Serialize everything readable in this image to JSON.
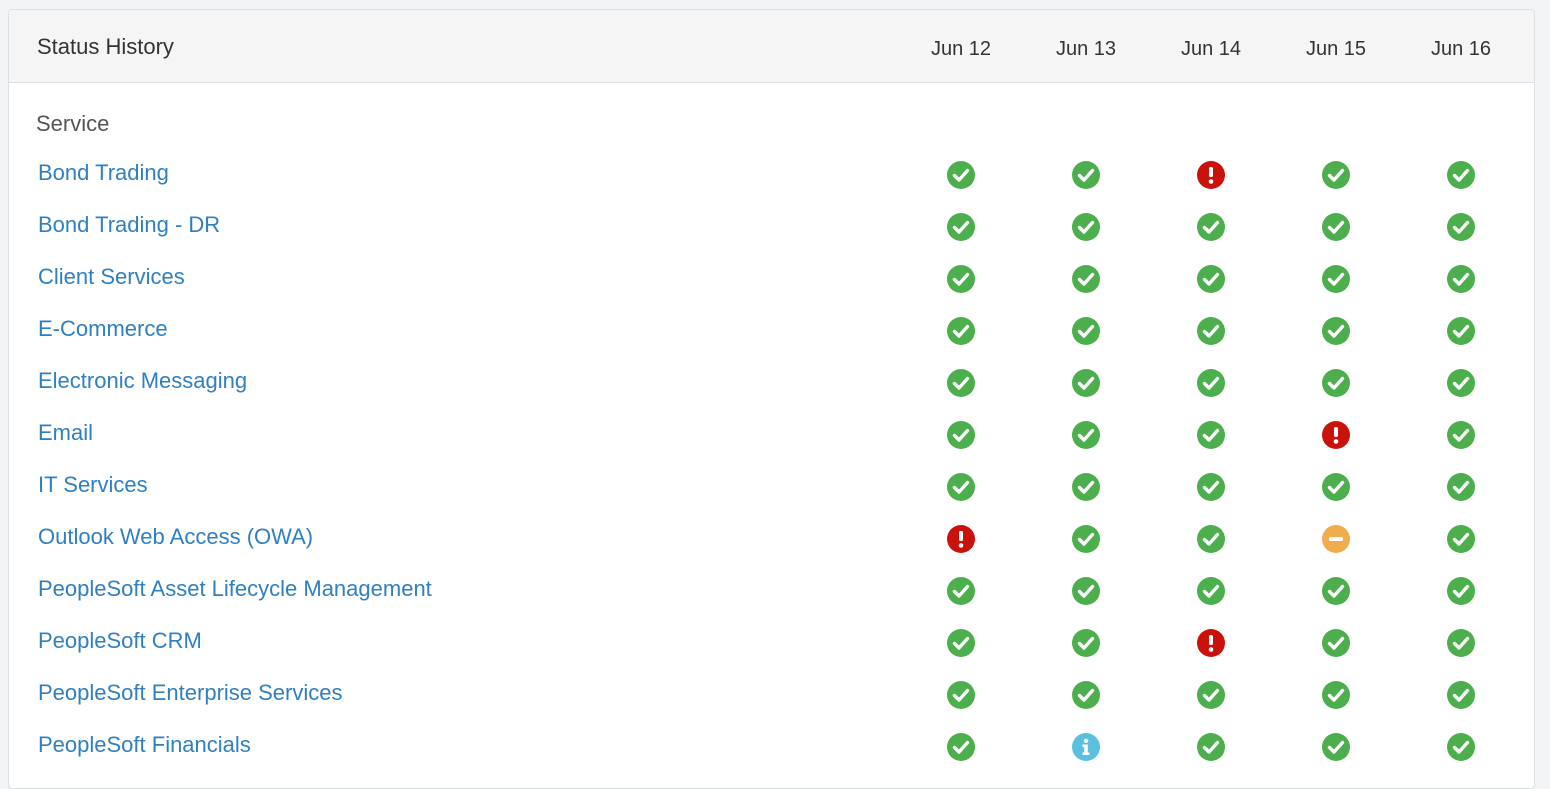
{
  "panel": {
    "title": "Status History",
    "section_label": "Service",
    "dates": [
      "Jun 12",
      "Jun 13",
      "Jun 14",
      "Jun 15",
      "Jun 16"
    ]
  },
  "status_colors": {
    "ok": "#4cae4c",
    "outage": "#c9120b",
    "degraded": "#f0ad4e",
    "info": "#5bc0de"
  },
  "status_icons": {
    "ok": "check-circle-icon",
    "outage": "exclamation-circle-icon",
    "degraded": "minus-circle-icon",
    "info": "info-circle-icon"
  },
  "services": [
    {
      "name": "Bond Trading",
      "statuses": [
        "ok",
        "ok",
        "outage",
        "ok",
        "ok"
      ]
    },
    {
      "name": "Bond Trading - DR",
      "statuses": [
        "ok",
        "ok",
        "ok",
        "ok",
        "ok"
      ]
    },
    {
      "name": "Client Services",
      "statuses": [
        "ok",
        "ok",
        "ok",
        "ok",
        "ok"
      ]
    },
    {
      "name": "E-Commerce",
      "statuses": [
        "ok",
        "ok",
        "ok",
        "ok",
        "ok"
      ]
    },
    {
      "name": "Electronic Messaging",
      "statuses": [
        "ok",
        "ok",
        "ok",
        "ok",
        "ok"
      ]
    },
    {
      "name": "Email",
      "statuses": [
        "ok",
        "ok",
        "ok",
        "outage",
        "ok"
      ]
    },
    {
      "name": "IT Services",
      "statuses": [
        "ok",
        "ok",
        "ok",
        "ok",
        "ok"
      ]
    },
    {
      "name": "Outlook Web Access (OWA)",
      "statuses": [
        "outage",
        "ok",
        "ok",
        "degraded",
        "ok"
      ]
    },
    {
      "name": "PeopleSoft Asset Lifecycle Management",
      "statuses": [
        "ok",
        "ok",
        "ok",
        "ok",
        "ok"
      ]
    },
    {
      "name": "PeopleSoft CRM",
      "statuses": [
        "ok",
        "ok",
        "outage",
        "ok",
        "ok"
      ]
    },
    {
      "name": "PeopleSoft Enterprise Services",
      "statuses": [
        "ok",
        "ok",
        "ok",
        "ok",
        "ok"
      ]
    },
    {
      "name": "PeopleSoft Financials",
      "statuses": [
        "ok",
        "info",
        "ok",
        "ok",
        "ok"
      ]
    }
  ]
}
